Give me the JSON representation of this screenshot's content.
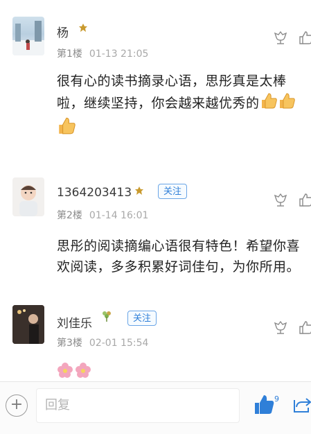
{
  "comments": [
    {
      "name": "杨",
      "badge_icon": "level-badge-icon",
      "floor": "第1楼",
      "time": "01-13 21:05",
      "text_lines": [
        "很有心的读书摘录心语，思彤真是太棒",
        "啦，继续坚持，你会越来越优秀的"
      ],
      "emoji": "thumbs-up-icon"
    },
    {
      "name": "1364203413",
      "badge_icon": "level-badge-icon",
      "follow_label": "关注",
      "floor": "第2楼",
      "time": "01-14 16:01",
      "text_lines": [
        "思彤的阅读摘编心语很有特色！希望你喜",
        "欢阅读，多多积累好词佳句，为你所用。"
      ]
    },
    {
      "name": "刘佳乐",
      "badge_icon": "flower-badge-icon",
      "follow_label": "关注",
      "floor": "第3楼",
      "time": "02-01 15:54",
      "emoji": "cherry-blossom-icon"
    }
  ],
  "bottom_bar": {
    "reply_placeholder": "回复",
    "like_count": "9",
    "accent_color": "#2f7fd8"
  }
}
